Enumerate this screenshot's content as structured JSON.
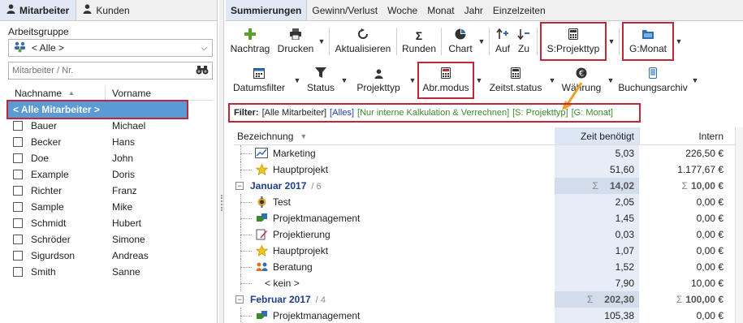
{
  "left": {
    "tabs": [
      {
        "label": "Mitarbeiter",
        "icon": "person-icon"
      },
      {
        "label": "Kunden",
        "icon": "person-icon"
      }
    ],
    "group_label": "Arbeitsgruppe",
    "group_value": "< Alle >",
    "search_placeholder": "Mitarbeiter / Nr.",
    "columns": {
      "lastname": "Nachname",
      "firstname": "Vorname"
    },
    "all_label": "< Alle Mitarbeiter >",
    "employees": [
      {
        "last": "Bauer",
        "first": "Michael"
      },
      {
        "last": "Becker",
        "first": "Hans"
      },
      {
        "last": "Doe",
        "first": "John"
      },
      {
        "last": "Example",
        "first": "Doris"
      },
      {
        "last": "Richter",
        "first": "Franz"
      },
      {
        "last": "Sample",
        "first": "Mike"
      },
      {
        "last": "Schmidt",
        "first": "Hubert"
      },
      {
        "last": "Schröder",
        "first": "Simone"
      },
      {
        "last": "Sigurdson",
        "first": "Andreas"
      },
      {
        "last": "Smith",
        "first": "Sanne"
      }
    ]
  },
  "right": {
    "tabs": [
      "Summierungen",
      "Gewinn/Verlust",
      "Woche",
      "Monat",
      "Jahr",
      "Einzelzeiten"
    ],
    "toolbar1": {
      "nachtrag": "Nachtrag",
      "drucken": "Drucken",
      "aktualisieren": "Aktualisieren",
      "runden": "Runden",
      "chart": "Chart",
      "auf": "Auf",
      "zu": "Zu",
      "projekttyp": "S:Projekttyp",
      "monat": "G:Monat"
    },
    "toolbar2": {
      "datumsfilter": "Datumsfilter",
      "status": "Status",
      "projekttyp": "Projekttyp",
      "abrmodus": "Abr.modus",
      "zeitststatus": "Zeitst.status",
      "waehrung": "Währung",
      "buchungsarchiv": "Buchungsarchiv"
    },
    "filter": {
      "label": "Filter:",
      "mitarbeiter": "[Alle Mitarbeiter]",
      "alles": "[Alles]",
      "kalkulation": "[Nur interne Kalkulation & Verrechnen]",
      "projekttyp": "[S: Projekttyp]",
      "monat": "[G: Monat]"
    },
    "grid": {
      "col_name": "Bezeichnung",
      "col_zeit": "Zeit benötigt",
      "col_intern": "Intern",
      "sigma": "Σ",
      "rows": [
        {
          "type": "item",
          "icon": "chart-icon",
          "label": "Marketing",
          "zeit": "5,03",
          "intern": "226,50 €"
        },
        {
          "type": "item",
          "icon": "star-icon",
          "label": "Hauptprojekt",
          "zeit": "51,60",
          "intern": "1.177,67 €"
        },
        {
          "type": "group",
          "label": "Januar 2017",
          "count": "/ 6",
          "zeit": "14,02",
          "intern": "10,00 €"
        },
        {
          "type": "item",
          "icon": "test-icon",
          "label": "Test",
          "zeit": "2,05",
          "intern": "0,00 €"
        },
        {
          "type": "item",
          "icon": "puzzle-icon",
          "label": "Projektmanagement",
          "zeit": "1,45",
          "intern": "0,00 €"
        },
        {
          "type": "item",
          "icon": "edit-icon",
          "label": "Projektierung",
          "zeit": "0,03",
          "intern": "0,00 €"
        },
        {
          "type": "item",
          "icon": "star-icon",
          "label": "Hauptprojekt",
          "zeit": "1,07",
          "intern": "0,00 €"
        },
        {
          "type": "item",
          "icon": "consulting-icon",
          "label": "Beratung",
          "zeit": "1,52",
          "intern": "0,00 €"
        },
        {
          "type": "item",
          "icon": "",
          "label": "< kein >",
          "zeit": "7,90",
          "intern": "10,00 €"
        },
        {
          "type": "group",
          "label": "Februar 2017",
          "count": "/ 4",
          "zeit": "202,30",
          "intern": "100,00 €"
        },
        {
          "type": "item",
          "icon": "puzzle-icon",
          "label": "Projektmanagement",
          "zeit": "105,38",
          "intern": "0,00 €"
        }
      ]
    }
  }
}
